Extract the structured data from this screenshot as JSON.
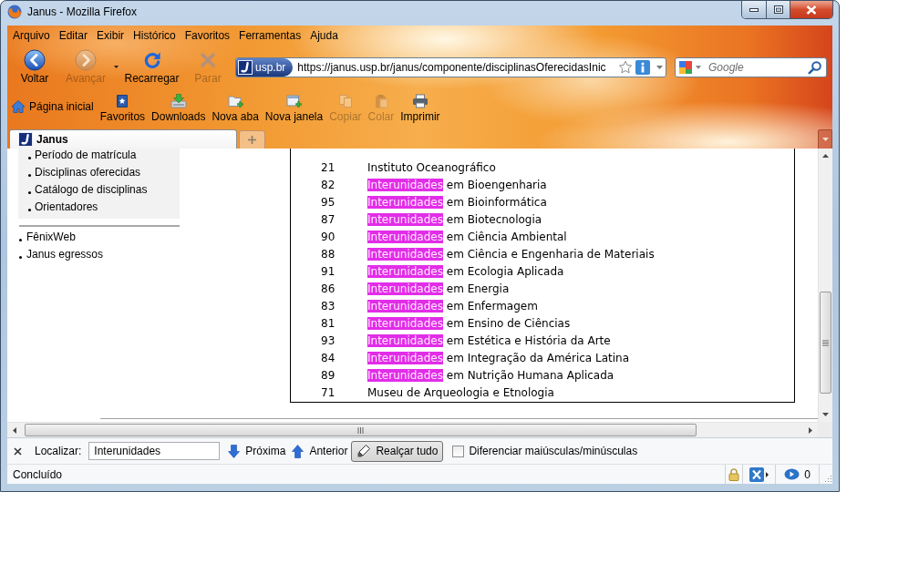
{
  "window": {
    "title": "Janus - Mozilla Firefox"
  },
  "menu_bar": [
    "Arquivo",
    "Editar",
    "Exibir",
    "Histórico",
    "Favoritos",
    "Ferramentas",
    "Ajuda"
  ],
  "navigation_toolbar": {
    "buttons": [
      {
        "kind": "back",
        "label": "Voltar",
        "disabled": false
      },
      {
        "kind": "forward",
        "label": "Avançar",
        "disabled": true
      },
      {
        "kind": "reload",
        "label": "Recarregar",
        "disabled": false
      },
      {
        "kind": "stop",
        "label": "Parar",
        "disabled": true
      }
    ],
    "address_bar": {
      "site": "usp.br",
      "value": "https://janus.usp.br/janus/componente/disciplinasOferecidasInic"
    },
    "search_bar": {
      "placeholder": "Google"
    }
  },
  "bookmarks_toolbar": [
    {
      "kind": "home",
      "label": "Página inicial",
      "disabled": false
    },
    {
      "kind": "bookmarks",
      "label": "Favoritos",
      "disabled": false
    },
    {
      "kind": "downloads",
      "label": "Downloads",
      "disabled": false
    },
    {
      "kind": "new_tab",
      "label": "Nova aba",
      "disabled": false
    },
    {
      "kind": "new_window",
      "label": "Nova janela",
      "disabled": false
    },
    {
      "kind": "copy",
      "label": "Copiar",
      "disabled": true
    },
    {
      "kind": "paste",
      "label": "Colar",
      "disabled": true
    },
    {
      "kind": "print",
      "label": "Imprimir",
      "disabled": false
    }
  ],
  "tabs": [
    {
      "label": "Janus",
      "selected": true
    }
  ],
  "page": {
    "sidebar_menu": [
      "Período de matrícula",
      "Disciplinas oferecidas",
      "Catálogo de disciplinas",
      "Orientadores"
    ],
    "sidebar_links": [
      "FênixWeb",
      "Janus egressos"
    ],
    "units_table": {
      "rows": [
        {
          "code": "21",
          "name_parts": [
            {
              "text": "Instituto Oceanográfico",
              "highlighted": false
            }
          ]
        },
        {
          "code": "82",
          "name_parts": [
            {
              "text": "Interunidades",
              "highlighted": true
            },
            {
              "text": " em Bioengenharia",
              "highlighted": false
            }
          ]
        },
        {
          "code": "95",
          "name_parts": [
            {
              "text": "Interunidades",
              "highlighted": true
            },
            {
              "text": " em Bioinformática",
              "highlighted": false
            }
          ]
        },
        {
          "code": "87",
          "name_parts": [
            {
              "text": "Interunidades",
              "highlighted": true
            },
            {
              "text": " em Biotecnologia",
              "highlighted": false
            }
          ]
        },
        {
          "code": "90",
          "name_parts": [
            {
              "text": "Interunidades",
              "highlighted": true
            },
            {
              "text": " em Ciência Ambiental",
              "highlighted": false
            }
          ]
        },
        {
          "code": "88",
          "name_parts": [
            {
              "text": "Interunidades",
              "highlighted": true
            },
            {
              "text": " em Ciência e Engenharia de Materiais",
              "highlighted": false
            }
          ]
        },
        {
          "code": "91",
          "name_parts": [
            {
              "text": "Interunidades",
              "highlighted": true
            },
            {
              "text": " em Ecologia Aplicada",
              "highlighted": false
            }
          ]
        },
        {
          "code": "86",
          "name_parts": [
            {
              "text": "Interunidades",
              "highlighted": true
            },
            {
              "text": " em Energia",
              "highlighted": false
            }
          ]
        },
        {
          "code": "83",
          "name_parts": [
            {
              "text": "Interunidades",
              "highlighted": true
            },
            {
              "text": " em Enfermagem",
              "highlighted": false
            }
          ]
        },
        {
          "code": "81",
          "name_parts": [
            {
              "text": "Interunidades",
              "highlighted": true
            },
            {
              "text": " em Ensino de Ciências",
              "highlighted": false
            }
          ]
        },
        {
          "code": "93",
          "name_parts": [
            {
              "text": "Interunidades",
              "highlighted": true
            },
            {
              "text": " em Estética e História da Arte",
              "highlighted": false
            }
          ]
        },
        {
          "code": "84",
          "name_parts": [
            {
              "text": "Interunidades",
              "highlighted": true
            },
            {
              "text": " em Integração da América Latina",
              "highlighted": false
            }
          ]
        },
        {
          "code": "89",
          "name_parts": [
            {
              "text": "Interunidades",
              "highlighted": true
            },
            {
              "text": " em Nutrição Humana Aplicada",
              "highlighted": false
            }
          ]
        },
        {
          "code": "71",
          "name_parts": [
            {
              "text": "Museu de Arqueologia e Etnologia",
              "highlighted": false
            }
          ]
        }
      ]
    }
  },
  "find_bar": {
    "label": "Localizar:",
    "value": "Interunidades",
    "next": "Próxima",
    "previous": "Anterior",
    "highlight_all": {
      "label": "Realçar tudo",
      "on": true
    },
    "match_case": {
      "label": "Diferenciar maiúsculas/minúsculas",
      "checked": false
    }
  },
  "status_bar": {
    "text": "Concluído",
    "count": "0"
  }
}
